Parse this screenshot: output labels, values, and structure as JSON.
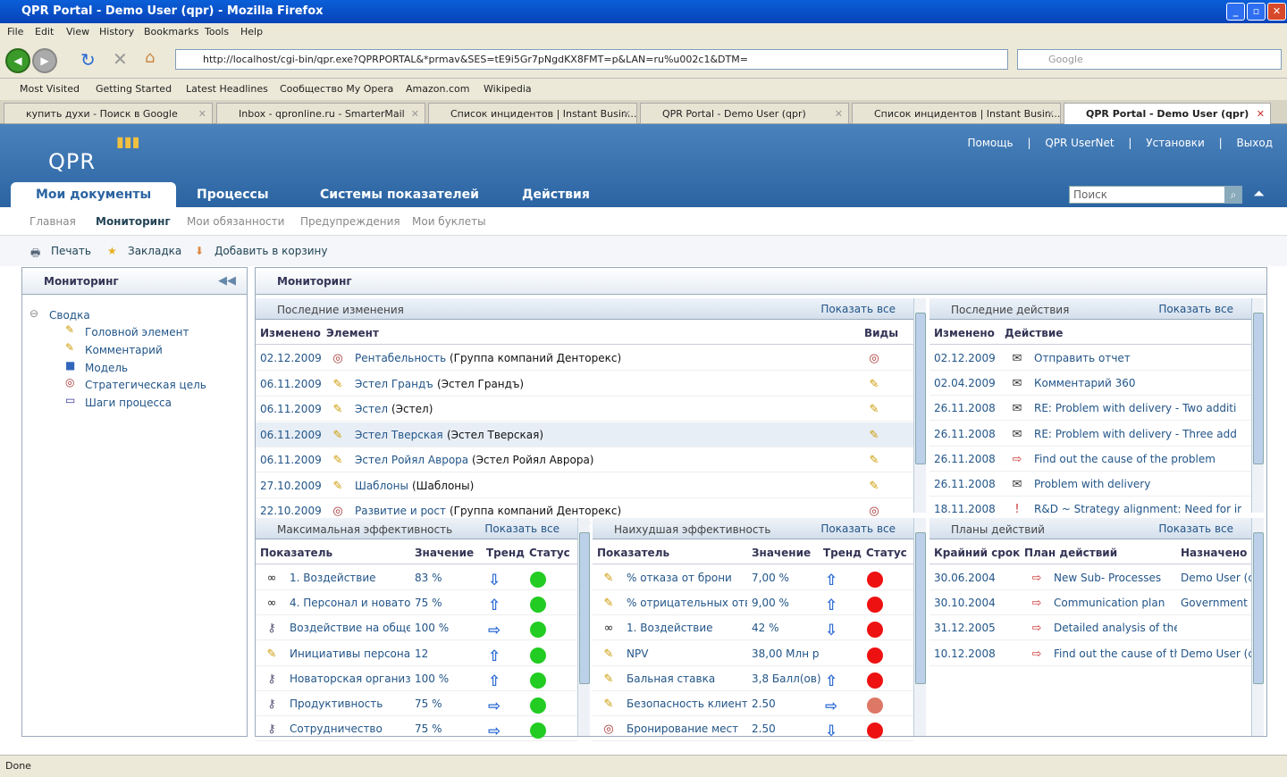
{
  "window": {
    "title": "QPR Portal - Demo User (qpr) - Mozilla Firefox"
  },
  "menu": [
    "File",
    "Edit",
    "View",
    "History",
    "Bookmarks",
    "Tools",
    "Help"
  ],
  "address": {
    "url": "http://localhost/cgi-bin/qpr.exe?QPRPORTAL&*prmav&SES=tE9i5Gr7pNgdKX8FMT=p&LAN=ru%u002c1&DTM=",
    "search_placeholder": "Google"
  },
  "bookmarks": [
    "Most Visited",
    "Getting Started",
    "Latest Headlines",
    "Сообщество My Opera",
    "Amazon.com",
    "Wikipedia"
  ],
  "tabs": [
    "купить духи - Поиск в Google",
    "Inbox - qpronline.ru - SmarterMail",
    "Список инцидентов | Instant Busin...",
    "QPR Portal - Demo User (qpr)",
    "Список инцидентов | Instant Busin...",
    "QPR Portal - Demo User (qpr)"
  ],
  "portal": {
    "logo": "QPR",
    "links": [
      "Помощь",
      "|",
      "QPR UserNet",
      "|",
      "Установки",
      "|",
      "Выход"
    ],
    "main_tabs": [
      "Мои документы",
      "Процессы",
      "Системы показателей",
      "Действия"
    ],
    "search_placeholder": "Поиск",
    "sub_nav": [
      "Главная",
      "Мониторинг",
      "Мои обязанности",
      "Предупреждения",
      "Мои буклеты"
    ],
    "toolbar": [
      "Печать",
      "Закладка",
      "Добавить в корзину"
    ],
    "left_title": "Мониторинг",
    "tree": [
      "Сводка",
      "Головной элемент",
      "Комментарий",
      "Модель",
      "Стратегическая цель",
      "Шаги процесса"
    ],
    "main_title": "Мониторинг",
    "show_all": "Показать все"
  },
  "recent_changes": {
    "title": "Последние изменения",
    "headers": [
      "Изменено",
      "Элемент",
      "Виды"
    ],
    "rows": [
      {
        "date": "02.12.2009",
        "link": "Рентабельность",
        "desc": "(Группа компаний Денторекс)",
        "icon": "target-icon"
      },
      {
        "date": "06.11.2009",
        "link": "Эстел Грандъ",
        "desc": "(Эстел Грандъ)",
        "icon": "ruler-icon"
      },
      {
        "date": "06.11.2009",
        "link": "Эстел",
        "desc": "(Эстел)",
        "icon": "ruler-icon"
      },
      {
        "date": "06.11.2009",
        "link": "Эстел Тверская",
        "desc": "(Эстел Тверская)",
        "icon": "ruler-icon"
      },
      {
        "date": "06.11.2009",
        "link": "Эстел Ройял Аврора",
        "desc": "(Эстел Ройял Аврора)",
        "icon": "ruler-icon"
      },
      {
        "date": "27.10.2009",
        "link": "Шаблоны",
        "desc": "(Шаблоны)",
        "icon": "ruler-icon"
      },
      {
        "date": "22.10.2009",
        "link": "Развитие и рост",
        "desc": "(Группа компаний Денторекс)",
        "icon": "target-icon"
      }
    ]
  },
  "recent_actions": {
    "title": "Последние действия",
    "headers": [
      "Изменено",
      "Действие"
    ],
    "rows": [
      {
        "date": "02.12.2009",
        "text": "Отправить отчет",
        "icon": "mail-icon"
      },
      {
        "date": "02.04.2009",
        "text": "Комментарий 360",
        "icon": "mail-icon"
      },
      {
        "date": "26.11.2008",
        "text": "RE: Problem with delivery - Two additi",
        "icon": "mail-icon"
      },
      {
        "date": "26.11.2008",
        "text": "RE: Problem with delivery - Three add",
        "icon": "mail-icon"
      },
      {
        "date": "26.11.2008",
        "text": "Find out the cause of the problem",
        "icon": "task-icon"
      },
      {
        "date": "26.11.2008",
        "text": "Problem with delivery",
        "icon": "mail-icon"
      },
      {
        "date": "18.11.2008",
        "text": "R&D ~ Strategy alignment: Need for ir",
        "icon": "alert-icon"
      }
    ]
  },
  "max_perf": {
    "title": "Максимальная эффективность",
    "headers": [
      "Показатель",
      "Значение",
      "Тренд",
      "Статус"
    ],
    "rows": [
      {
        "name": "1. Воздействие",
        "value": "83 %",
        "trend": "down",
        "status": "#22cc22",
        "icon": "binoculars-icon"
      },
      {
        "name": "4. Персонал и новато",
        "value": "75 %",
        "trend": "up",
        "status": "#22cc22",
        "icon": "binoculars-icon"
      },
      {
        "name": "Воздействие на обще",
        "value": "100 %",
        "trend": "right",
        "status": "#22cc22",
        "icon": "key-icon"
      },
      {
        "name": "Инициативы персонал",
        "value": "12",
        "trend": "up",
        "status": "#22cc22",
        "icon": "ruler-icon"
      },
      {
        "name": "Новаторская организа",
        "value": "100 %",
        "trend": "up",
        "status": "#22cc22",
        "icon": "key-icon"
      },
      {
        "name": "Продуктивность",
        "value": "75 %",
        "trend": "right",
        "status": "#22cc22",
        "icon": "key-icon"
      },
      {
        "name": "Сотрудничество",
        "value": "75 %",
        "trend": "right",
        "status": "#22cc22",
        "icon": "key-icon"
      }
    ]
  },
  "worst_perf": {
    "title": "Наихудшая эффективность",
    "headers": [
      "Показатель",
      "Значение",
      "Тренд",
      "Статус"
    ],
    "rows": [
      {
        "name": "% отказа от брони",
        "value": "7,00 %",
        "trend": "up",
        "status": "#ee1111",
        "icon": "ruler-icon"
      },
      {
        "name": "% отрицательных отв",
        "value": "9,00 %",
        "trend": "up",
        "status": "#ee1111",
        "icon": "ruler-icon"
      },
      {
        "name": "1. Воздействие",
        "value": "42 %",
        "trend": "down",
        "status": "#ee1111",
        "icon": "binoculars-icon"
      },
      {
        "name": "NPV",
        "value": "38,00 Млн р",
        "trend": "",
        "status": "#ee1111",
        "icon": "ruler-icon"
      },
      {
        "name": "Бальная ставка",
        "value": "3,8 Балл(ов)",
        "trend": "up",
        "status": "#ee1111",
        "icon": "ruler-icon"
      },
      {
        "name": "Безопасность клиента",
        "value": "2.50",
        "trend": "right",
        "status": "#dd7766",
        "icon": "ruler-icon"
      },
      {
        "name": "Бронирование мест",
        "value": "2.50",
        "trend": "down",
        "status": "#ee1111",
        "icon": "target-icon"
      }
    ]
  },
  "action_plans": {
    "title": "Планы действий",
    "headers": [
      "Крайний срок",
      "План действий",
      "Назначено"
    ],
    "rows": [
      {
        "date": "30.06.2004",
        "plan": "New Sub- Processes",
        "assigned": "Demo User (c"
      },
      {
        "date": "30.10.2004",
        "plan": "Communication plan",
        "assigned": "Government ("
      },
      {
        "date": "31.12.2005",
        "plan": "Detailed analysis of the si",
        "assigned": ""
      },
      {
        "date": "10.12.2008",
        "plan": "Find out the cause of th",
        "assigned": "Demo User (c"
      }
    ]
  },
  "status": "Done"
}
